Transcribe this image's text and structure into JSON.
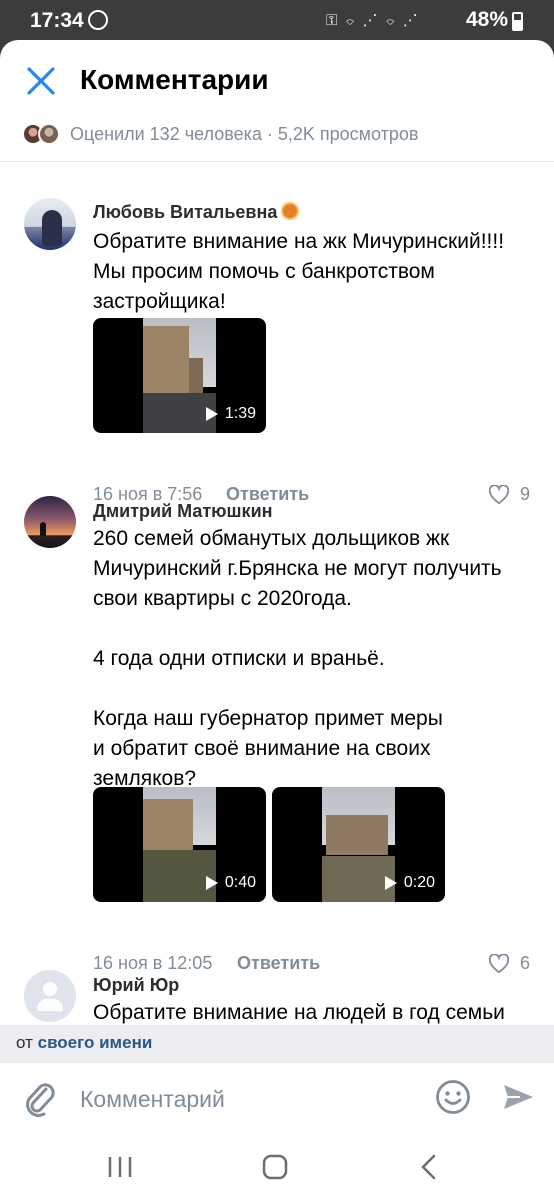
{
  "status_bar": {
    "time": "17:34",
    "battery": "48%",
    "icons": "⚿ ⌔ ⋰ ⌔ ⋰"
  },
  "header": {
    "title": "Комментарии",
    "likes_summary": "Оценили 132 человека · 5,2K просмотров"
  },
  "comments": [
    {
      "author": "Любовь Витальевна",
      "text": "Обратите внимание на жк Мичуринский!!!! Мы просим помочь с банкротством застройщика!",
      "videos": [
        {
          "duration": "1:39"
        }
      ],
      "date": "16 ноя в 7:56",
      "reply_label": "Ответить",
      "likes": "9"
    },
    {
      "author": "Дмитрий Матюшкин",
      "text": "260 семей обманутых дольщиков жк Мичуринский г.Брянска не могут получить свои квартиры с 2020года.\n\n4 года одни отписки и враньё.\n\nКогда наш губернатор примет меры\nи обратит своё внимание на своих земляков?",
      "videos": [
        {
          "duration": "0:40"
        },
        {
          "duration": "0:20"
        }
      ],
      "date": "16 ноя в 12:05",
      "reply_label": "Ответить",
      "likes": "6"
    },
    {
      "author": "Юрий Юр",
      "text": "Обратите внимание на людей в год семьи"
    }
  ],
  "composer": {
    "from_prefix": "от",
    "from_link": "своего имени",
    "placeholder": "Комментарий"
  }
}
